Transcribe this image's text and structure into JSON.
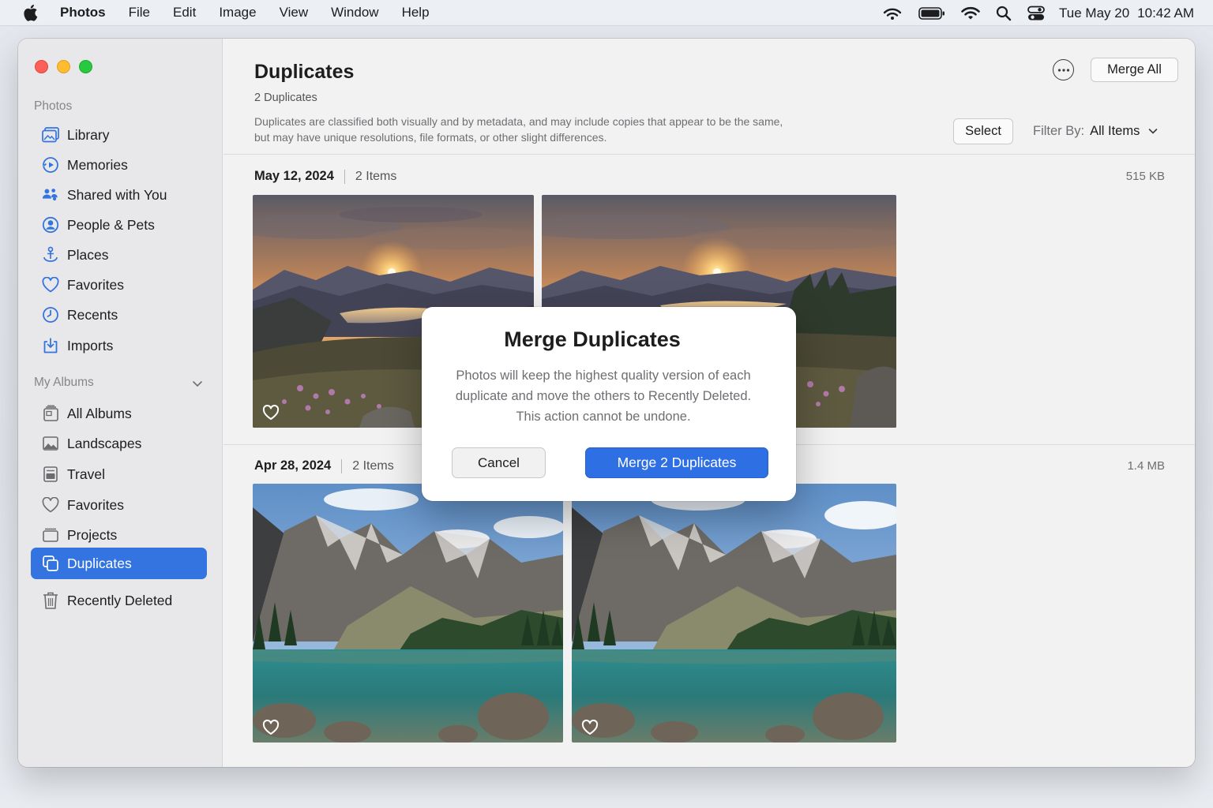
{
  "menubar": {
    "app_name": "Photos",
    "menus": [
      "File",
      "Edit",
      "Image",
      "View",
      "Window",
      "Help"
    ],
    "clock_date": "Tue May 20",
    "clock_time": "10:42 AM",
    "status_icons": [
      "airdrop-icon",
      "battery-icon",
      "wifi-icon",
      "search-icon",
      "control-center-icon"
    ]
  },
  "sidebar": {
    "section_photos": "Photos",
    "library_items": [
      {
        "label": "Library",
        "icon": "library-icon"
      },
      {
        "label": "Memories",
        "icon": "memories-icon"
      },
      {
        "label": "Shared with You",
        "icon": "shared-icon"
      },
      {
        "label": "People & Pets",
        "icon": "person-icon"
      },
      {
        "label": "Places",
        "icon": "places-icon"
      },
      {
        "label": "Favorites",
        "icon": "heart-icon"
      },
      {
        "label": "Recents",
        "icon": "clock-icon"
      },
      {
        "label": "Imports",
        "icon": "import-icon"
      }
    ],
    "section_albums": "My Albums",
    "album_items": [
      {
        "label": "All Albums",
        "icon": "albums-icon"
      },
      {
        "label": "Landscapes",
        "icon": "photo-icon"
      },
      {
        "label": "Travel",
        "icon": "travel-icon"
      },
      {
        "label": "Favorites",
        "icon": "heart-icon"
      },
      {
        "label": "Projects",
        "icon": "folder-icon"
      },
      {
        "label": "Duplicates",
        "icon": "duplicates-icon",
        "selected": true
      },
      {
        "label": "Recently Deleted",
        "icon": "trash-icon"
      }
    ]
  },
  "header": {
    "title": "Duplicates",
    "count": "2 Duplicates",
    "description_line1": "Duplicates are classified both visually and by metadata, and may include copies that appear to be the same,",
    "description_line2": "but may have unique resolutions, file formats, or other slight differences.",
    "merge_all_label": "Merge All",
    "select_label": "Select",
    "filter_label": "Filter By:",
    "filter_value": "All Items"
  },
  "groups": [
    {
      "date": "May 12, 2024",
      "items": "2 Items",
      "size": "515 KB",
      "scene": "sunset-lake"
    },
    {
      "date": "Apr 28, 2024",
      "items": "2 Items",
      "size": "1.4 MB",
      "scene": "mountain-lake"
    }
  ],
  "dialog": {
    "title": "Merge Duplicates",
    "message_line1": "Photos will keep the highest quality version of each",
    "message_line2": "duplicate and move the others to Recently Deleted.",
    "message_line3": "This action cannot be undone.",
    "cancel_label": "Cancel",
    "confirm_label": "Merge 2 Duplicates"
  },
  "colors": {
    "accent": "#3474e0",
    "confirm_button": "#2f6fe4"
  }
}
